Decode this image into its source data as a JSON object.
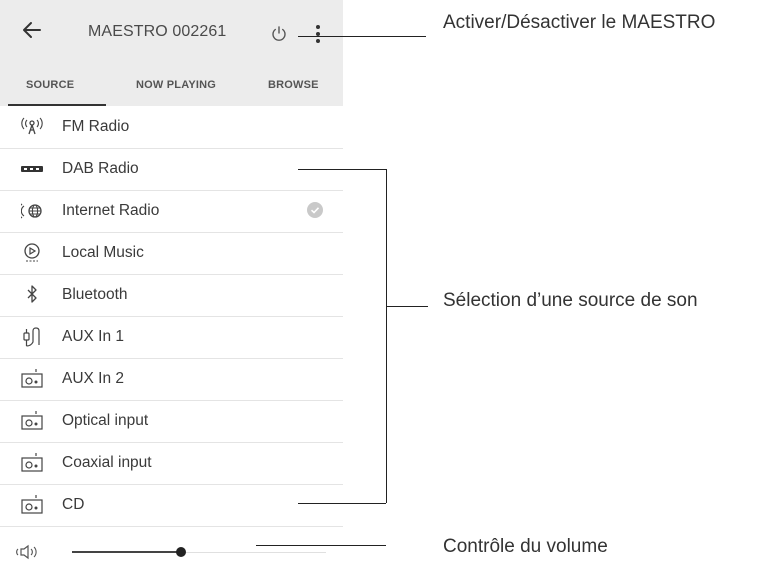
{
  "header": {
    "title": "MAESTRO 002261",
    "back_icon": "arrow-left-icon",
    "power_icon": "power-icon",
    "more_icon": "more-vert-icon"
  },
  "tabs": [
    {
      "label": "SOURCE",
      "active": true
    },
    {
      "label": "NOW PLAYING",
      "active": false
    },
    {
      "label": "BROWSE",
      "active": false
    }
  ],
  "sources": [
    {
      "label": "FM Radio",
      "icon": "fm-antenna-icon"
    },
    {
      "label": "DAB Radio",
      "icon": "dab-logo-icon"
    },
    {
      "label": "Internet Radio",
      "icon": "internet-radio-icon",
      "selected": true
    },
    {
      "label": "Local Music",
      "icon": "local-music-icon"
    },
    {
      "label": "Bluetooth",
      "icon": "bluetooth-icon"
    },
    {
      "label": "AUX In 1",
      "icon": "aux-plug-icon"
    },
    {
      "label": "AUX In 2",
      "icon": "device-icon"
    },
    {
      "label": "Optical input",
      "icon": "device-icon"
    },
    {
      "label": "Coaxial input",
      "icon": "device-icon"
    },
    {
      "label": "CD",
      "icon": "device-icon"
    }
  ],
  "volume": {
    "icon": "speaker-icon",
    "level": 0.43
  },
  "annotations": {
    "power": "Activer/Désactiver le MAESTRO",
    "source": "Sélection d’une source de son",
    "volume": "Contrôle du volume"
  },
  "colors": {
    "header_bg": "#ececec",
    "check": "#c9c9c9"
  }
}
